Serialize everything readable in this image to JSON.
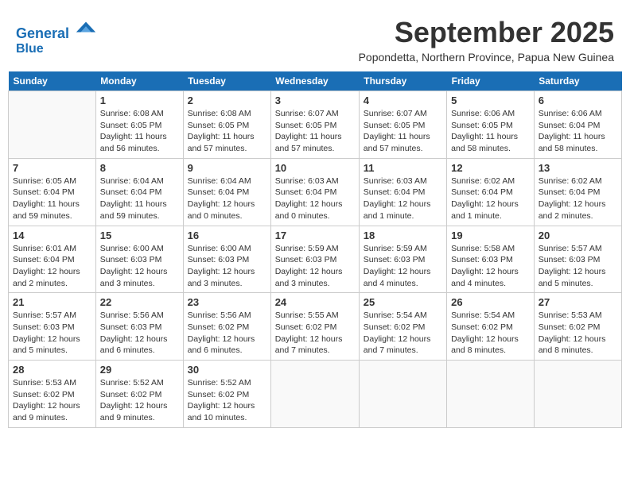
{
  "header": {
    "logo_line1": "General",
    "logo_line2": "Blue",
    "month": "September 2025",
    "location": "Popondetta, Northern Province, Papua New Guinea"
  },
  "days_of_week": [
    "Sunday",
    "Monday",
    "Tuesday",
    "Wednesday",
    "Thursday",
    "Friday",
    "Saturday"
  ],
  "weeks": [
    [
      {
        "day": "",
        "info": ""
      },
      {
        "day": "1",
        "info": "Sunrise: 6:08 AM\nSunset: 6:05 PM\nDaylight: 11 hours\nand 56 minutes."
      },
      {
        "day": "2",
        "info": "Sunrise: 6:08 AM\nSunset: 6:05 PM\nDaylight: 11 hours\nand 57 minutes."
      },
      {
        "day": "3",
        "info": "Sunrise: 6:07 AM\nSunset: 6:05 PM\nDaylight: 11 hours\nand 57 minutes."
      },
      {
        "day": "4",
        "info": "Sunrise: 6:07 AM\nSunset: 6:05 PM\nDaylight: 11 hours\nand 57 minutes."
      },
      {
        "day": "5",
        "info": "Sunrise: 6:06 AM\nSunset: 6:05 PM\nDaylight: 11 hours\nand 58 minutes."
      },
      {
        "day": "6",
        "info": "Sunrise: 6:06 AM\nSunset: 6:04 PM\nDaylight: 11 hours\nand 58 minutes."
      }
    ],
    [
      {
        "day": "7",
        "info": "Sunrise: 6:05 AM\nSunset: 6:04 PM\nDaylight: 11 hours\nand 59 minutes."
      },
      {
        "day": "8",
        "info": "Sunrise: 6:04 AM\nSunset: 6:04 PM\nDaylight: 11 hours\nand 59 minutes."
      },
      {
        "day": "9",
        "info": "Sunrise: 6:04 AM\nSunset: 6:04 PM\nDaylight: 12 hours\nand 0 minutes."
      },
      {
        "day": "10",
        "info": "Sunrise: 6:03 AM\nSunset: 6:04 PM\nDaylight: 12 hours\nand 0 minutes."
      },
      {
        "day": "11",
        "info": "Sunrise: 6:03 AM\nSunset: 6:04 PM\nDaylight: 12 hours\nand 1 minute."
      },
      {
        "day": "12",
        "info": "Sunrise: 6:02 AM\nSunset: 6:04 PM\nDaylight: 12 hours\nand 1 minute."
      },
      {
        "day": "13",
        "info": "Sunrise: 6:02 AM\nSunset: 6:04 PM\nDaylight: 12 hours\nand 2 minutes."
      }
    ],
    [
      {
        "day": "14",
        "info": "Sunrise: 6:01 AM\nSunset: 6:04 PM\nDaylight: 12 hours\nand 2 minutes."
      },
      {
        "day": "15",
        "info": "Sunrise: 6:00 AM\nSunset: 6:03 PM\nDaylight: 12 hours\nand 3 minutes."
      },
      {
        "day": "16",
        "info": "Sunrise: 6:00 AM\nSunset: 6:03 PM\nDaylight: 12 hours\nand 3 minutes."
      },
      {
        "day": "17",
        "info": "Sunrise: 5:59 AM\nSunset: 6:03 PM\nDaylight: 12 hours\nand 3 minutes."
      },
      {
        "day": "18",
        "info": "Sunrise: 5:59 AM\nSunset: 6:03 PM\nDaylight: 12 hours\nand 4 minutes."
      },
      {
        "day": "19",
        "info": "Sunrise: 5:58 AM\nSunset: 6:03 PM\nDaylight: 12 hours\nand 4 minutes."
      },
      {
        "day": "20",
        "info": "Sunrise: 5:57 AM\nSunset: 6:03 PM\nDaylight: 12 hours\nand 5 minutes."
      }
    ],
    [
      {
        "day": "21",
        "info": "Sunrise: 5:57 AM\nSunset: 6:03 PM\nDaylight: 12 hours\nand 5 minutes."
      },
      {
        "day": "22",
        "info": "Sunrise: 5:56 AM\nSunset: 6:03 PM\nDaylight: 12 hours\nand 6 minutes."
      },
      {
        "day": "23",
        "info": "Sunrise: 5:56 AM\nSunset: 6:02 PM\nDaylight: 12 hours\nand 6 minutes."
      },
      {
        "day": "24",
        "info": "Sunrise: 5:55 AM\nSunset: 6:02 PM\nDaylight: 12 hours\nand 7 minutes."
      },
      {
        "day": "25",
        "info": "Sunrise: 5:54 AM\nSunset: 6:02 PM\nDaylight: 12 hours\nand 7 minutes."
      },
      {
        "day": "26",
        "info": "Sunrise: 5:54 AM\nSunset: 6:02 PM\nDaylight: 12 hours\nand 8 minutes."
      },
      {
        "day": "27",
        "info": "Sunrise: 5:53 AM\nSunset: 6:02 PM\nDaylight: 12 hours\nand 8 minutes."
      }
    ],
    [
      {
        "day": "28",
        "info": "Sunrise: 5:53 AM\nSunset: 6:02 PM\nDaylight: 12 hours\nand 9 minutes."
      },
      {
        "day": "29",
        "info": "Sunrise: 5:52 AM\nSunset: 6:02 PM\nDaylight: 12 hours\nand 9 minutes."
      },
      {
        "day": "30",
        "info": "Sunrise: 5:52 AM\nSunset: 6:02 PM\nDaylight: 12 hours\nand 10 minutes."
      },
      {
        "day": "",
        "info": ""
      },
      {
        "day": "",
        "info": ""
      },
      {
        "day": "",
        "info": ""
      },
      {
        "day": "",
        "info": ""
      }
    ]
  ]
}
